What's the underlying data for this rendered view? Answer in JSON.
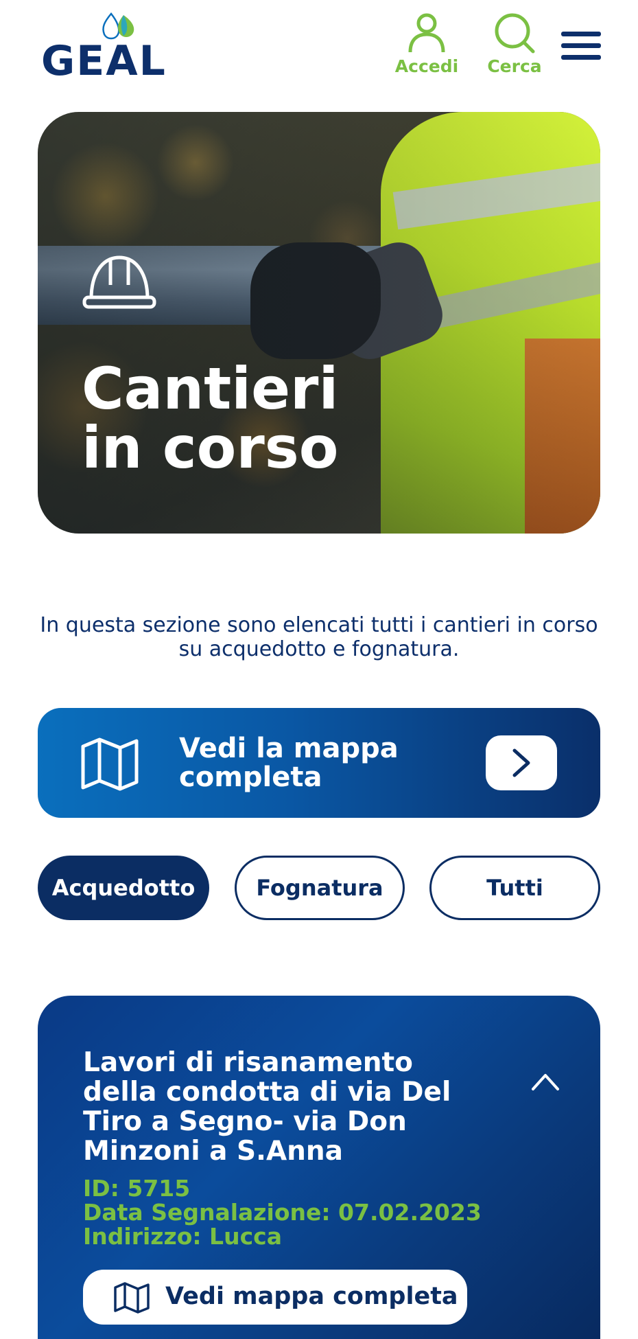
{
  "header": {
    "logo_text": "GEAL",
    "accedi_label": "Accedi",
    "cerca_label": "Cerca",
    "menu_icon": "hamburger-menu-icon",
    "accent_color": "#7bc043",
    "brand_color": "#0d2f6b"
  },
  "hero": {
    "title_line1": "Cantieri",
    "title_line2": "in corso",
    "icon": "hard-hat-icon"
  },
  "intro": {
    "text": "In questa sezione sono elencati tutti i cantieri in corso su acquedotto e fognatura."
  },
  "map_banner": {
    "label": "Vedi la mappa completa",
    "icon": "map-icon",
    "go_icon": "chevron-right-icon"
  },
  "filters": {
    "items": [
      {
        "label": "Acquedotto",
        "active": true
      },
      {
        "label": "Fognatura",
        "active": false
      },
      {
        "label": "Tutti",
        "active": false
      }
    ]
  },
  "card": {
    "title": "Lavori di risanamento della condotta di via Del Tiro a Segno- via Don Minzoni a S.Anna",
    "id_line": "ID: 5715",
    "date_line": "Data Segnalazione: 07.02.2023",
    "address_line": "Indirizzo: Lucca",
    "map_button_label": "Vedi mappa completa",
    "collapse_icon": "chevron-up-icon"
  }
}
